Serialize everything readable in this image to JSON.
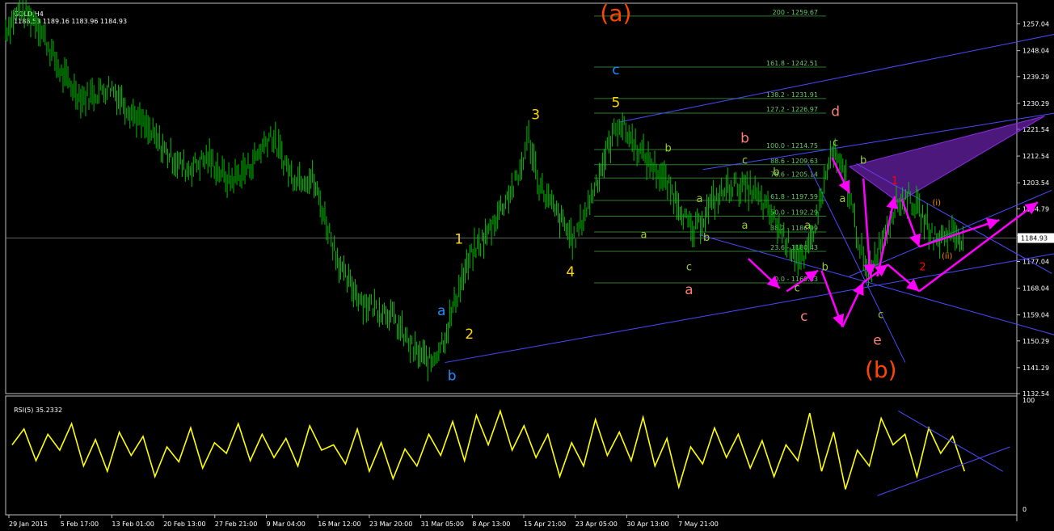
{
  "header": {
    "symbol": "GOLD,H4",
    "ohlc": "1188.53 1189.16 1183.96 1184.93",
    "rsi_label": "RSI(5) 35.2332"
  },
  "colors": {
    "background": "#000000",
    "grid_border": "#c0c0c0",
    "bars": "#00c000",
    "rsi": "#ffff00",
    "channel": "#4b4bff",
    "fib": "#2e7d2e",
    "fib_text": "#6ec86e",
    "magenta": "#ff00ff",
    "purple_pattern": "#8a2be2"
  },
  "chart_data": [
    {
      "type": "line",
      "title": "GOLD,H4",
      "xlabel": "",
      "ylabel": "",
      "ylim": [
        1132.54,
        1264.0
      ],
      "grid": false,
      "x_tick_labels": [
        "29 Jan 2015",
        "5 Feb 17:00",
        "13 Feb 01:00",
        "20 Feb 13:00",
        "27 Feb 21:00",
        "9 Mar 04:00",
        "16 Mar 12:00",
        "23 Mar 20:00",
        "31 Mar 05:00",
        "8 Apr 13:00",
        "15 Apr 21:00",
        "23 Apr 05:00",
        "30 Apr 13:00",
        "7 May 21:00"
      ],
      "y_tick_labels": [
        "1257.04",
        "1248.04",
        "1239.29",
        "1230.29",
        "1221.54",
        "1212.54",
        "1203.54",
        "1194.79",
        "1185.79",
        "1177.04",
        "1168.04",
        "1159.04",
        "1150.29",
        "1141.29",
        "1132.54"
      ],
      "y_ticks": [
        1257.04,
        1248.04,
        1239.29,
        1230.29,
        1221.54,
        1212.54,
        1203.54,
        1194.79,
        1185.79,
        1177.04,
        1168.04,
        1159.04,
        1150.29,
        1141.29,
        1132.54
      ],
      "current_price": "1184.93",
      "price_path": [
        {
          "x": 0,
          "y": 1255
        },
        {
          "x": 4,
          "y": 1262
        },
        {
          "x": 9,
          "y": 1258
        },
        {
          "x": 16,
          "y": 1240
        },
        {
          "x": 22,
          "y": 1232
        },
        {
          "x": 30,
          "y": 1236
        },
        {
          "x": 38,
          "y": 1225
        },
        {
          "x": 46,
          "y": 1214
        },
        {
          "x": 52,
          "y": 1208
        },
        {
          "x": 58,
          "y": 1212
        },
        {
          "x": 64,
          "y": 1204
        },
        {
          "x": 70,
          "y": 1209
        },
        {
          "x": 76,
          "y": 1220
        },
        {
          "x": 82,
          "y": 1206
        },
        {
          "x": 88,
          "y": 1205
        },
        {
          "x": 92,
          "y": 1190
        },
        {
          "x": 97,
          "y": 1172
        },
        {
          "x": 103,
          "y": 1163
        },
        {
          "x": 110,
          "y": 1160
        },
        {
          "x": 117,
          "y": 1147
        },
        {
          "x": 122,
          "y": 1143
        },
        {
          "x": 126,
          "y": 1152
        },
        {
          "x": 130,
          "y": 1168
        },
        {
          "x": 134,
          "y": 1180
        },
        {
          "x": 138,
          "y": 1186
        },
        {
          "x": 142,
          "y": 1195
        },
        {
          "x": 147,
          "y": 1205
        },
        {
          "x": 150,
          "y": 1219
        },
        {
          "x": 153,
          "y": 1203
        },
        {
          "x": 158,
          "y": 1193
        },
        {
          "x": 163,
          "y": 1184
        },
        {
          "x": 168,
          "y": 1199
        },
        {
          "x": 173,
          "y": 1216
        },
        {
          "x": 176,
          "y": 1224
        },
        {
          "x": 182,
          "y": 1214
        },
        {
          "x": 188,
          "y": 1206
        },
        {
          "x": 193,
          "y": 1197
        },
        {
          "x": 197,
          "y": 1186
        },
        {
          "x": 202,
          "y": 1196
        },
        {
          "x": 208,
          "y": 1203
        },
        {
          "x": 214,
          "y": 1201
        },
        {
          "x": 220,
          "y": 1192
        },
        {
          "x": 225,
          "y": 1182
        },
        {
          "x": 229,
          "y": 1176
        },
        {
          "x": 233,
          "y": 1194
        },
        {
          "x": 237,
          "y": 1214
        },
        {
          "x": 241,
          "y": 1205
        },
        {
          "x": 244,
          "y": 1188
        },
        {
          "x": 247,
          "y": 1172
        },
        {
          "x": 251,
          "y": 1183
        },
        {
          "x": 255,
          "y": 1196
        },
        {
          "x": 259,
          "y": 1199
        },
        {
          "x": 263,
          "y": 1192
        },
        {
          "x": 267,
          "y": 1184
        },
        {
          "x": 271,
          "y": 1187
        },
        {
          "x": 275,
          "y": 1184.93
        }
      ],
      "annotations": [
        {
          "text": "(a)",
          "x": 175,
          "y": 1258,
          "color": "#ff4500",
          "size": "large"
        },
        {
          "text": "c",
          "x": 175,
          "y": 1240,
          "color": "#1e90ff",
          "size": "medium"
        },
        {
          "text": "5",
          "x": 175,
          "y": 1229,
          "color": "#ffd700",
          "size": "medium"
        },
        {
          "text": "3",
          "x": 152,
          "y": 1225,
          "color": "#ffd700",
          "size": "medium"
        },
        {
          "text": "1",
          "x": 130,
          "y": 1183,
          "color": "#ffd700",
          "size": "medium"
        },
        {
          "text": "2",
          "x": 133,
          "y": 1151,
          "color": "#ffd700",
          "size": "medium"
        },
        {
          "text": "4",
          "x": 162,
          "y": 1172,
          "color": "#ffd700",
          "size": "medium"
        },
        {
          "text": "a",
          "x": 125,
          "y": 1159,
          "color": "#1e90ff",
          "size": "medium"
        },
        {
          "text": "b",
          "x": 128,
          "y": 1137,
          "color": "#1e90ff",
          "size": "medium"
        },
        {
          "text": "b",
          "x": 190,
          "y": 1214,
          "color": "#9acd32",
          "size": "small"
        },
        {
          "text": "a",
          "x": 183,
          "y": 1185,
          "color": "#9acd32",
          "size": "small"
        },
        {
          "text": "a",
          "x": 199,
          "y": 1197,
          "color": "#9acd32",
          "size": "small"
        },
        {
          "text": "b",
          "x": 201,
          "y": 1184,
          "color": "#9acd32",
          "size": "small"
        },
        {
          "text": "c",
          "x": 196,
          "y": 1174,
          "color": "#9acd32",
          "size": "small"
        },
        {
          "text": "c",
          "x": 212,
          "y": 1210,
          "color": "#9acd32",
          "size": "small"
        },
        {
          "text": "a",
          "x": 212,
          "y": 1188,
          "color": "#9acd32",
          "size": "small"
        },
        {
          "text": "b",
          "x": 221,
          "y": 1206,
          "color": "#9acd32",
          "size": "small"
        },
        {
          "text": "b",
          "x": 212,
          "y": 1217,
          "color": "#fa8072",
          "size": "medium"
        },
        {
          "text": "a",
          "x": 196,
          "y": 1166,
          "color": "#fa8072",
          "size": "medium"
        },
        {
          "text": "a",
          "x": 230,
          "y": 1188,
          "color": "#9acd32",
          "size": "small"
        },
        {
          "text": "b",
          "x": 235,
          "y": 1174,
          "color": "#9acd32",
          "size": "small"
        },
        {
          "text": "c",
          "x": 227,
          "y": 1167,
          "color": "#9acd32",
          "size": "small"
        },
        {
          "text": "c",
          "x": 229,
          "y": 1157,
          "color": "#fa8072",
          "size": "medium"
        },
        {
          "text": "d",
          "x": 238,
          "y": 1226,
          "color": "#fa8072",
          "size": "medium"
        },
        {
          "text": "c",
          "x": 238,
          "y": 1216,
          "color": "#9acd32",
          "size": "small"
        },
        {
          "text": "b",
          "x": 246,
          "y": 1210,
          "color": "#9acd32",
          "size": "small"
        },
        {
          "text": "a",
          "x": 240,
          "y": 1197,
          "color": "#9acd32",
          "size": "small"
        },
        {
          "text": "c",
          "x": 251,
          "y": 1158,
          "color": "#9acd32",
          "size": "small"
        },
        {
          "text": "e",
          "x": 250,
          "y": 1149,
          "color": "#fa8072",
          "size": "medium"
        },
        {
          "text": "(b)",
          "x": 251,
          "y": 1138,
          "color": "#ff4500",
          "size": "large"
        },
        {
          "text": "1",
          "x": 255,
          "y": 1203,
          "color": "#ff0000",
          "size": "small"
        },
        {
          "text": "2",
          "x": 263,
          "y": 1174,
          "color": "#ff0000",
          "size": "small"
        },
        {
          "text": "(i)",
          "x": 267,
          "y": 1196,
          "color": "#ff8c00",
          "size": "tiny"
        },
        {
          "text": "(ii)",
          "x": 270,
          "y": 1178,
          "color": "#ff8c00",
          "size": "tiny"
        }
      ],
      "fibonacci": [
        {
          "label": "200 - 1259.67",
          "value": 1259.67
        },
        {
          "label": "161.8 - 1242.51",
          "value": 1242.51
        },
        {
          "label": "138.2 - 1231.91",
          "value": 1231.91
        },
        {
          "label": "127.2 - 1226.97",
          "value": 1226.97
        },
        {
          "label": "100.0 - 1214.75",
          "value": 1214.75
        },
        {
          "label": "88.6 - 1209.63",
          "value": 1209.63
        },
        {
          "label": "78.6 - 1205.14",
          "value": 1205.14
        },
        {
          "label": "61.8 - 1197.59",
          "value": 1197.59
        },
        {
          "label": "50.0 - 1192.29",
          "value": 1192.29
        },
        {
          "label": "38.2 - 1186.99",
          "value": 1186.99
        },
        {
          "label": "23.6 - 1180.43",
          "value": 1180.43
        },
        {
          "label": "0.0 - 1169.83",
          "value": 1169.83
        }
      ],
      "trendlines": [
        {
          "x1": 176,
          "y1": 1224,
          "x2": 345,
          "y2": 1264
        },
        {
          "x1": 200,
          "y1": 1208,
          "x2": 370,
          "y2": 1240
        },
        {
          "x1": 126,
          "y1": 1143,
          "x2": 393,
          "y2": 1199
        },
        {
          "x1": 199,
          "y1": 1186,
          "x2": 335,
          "y2": 1141
        },
        {
          "x1": 230,
          "y1": 1210,
          "x2": 258,
          "y2": 1143
        },
        {
          "x1": 244,
          "y1": 1210,
          "x2": 300,
          "y2": 1173
        },
        {
          "x1": 242,
          "y1": 1172,
          "x2": 300,
          "y2": 1201
        }
      ],
      "pattern_triangle": [
        {
          "x": 242,
          "y": 1209
        },
        {
          "x": 298,
          "y": 1226
        },
        {
          "x": 256,
          "y": 1197
        }
      ],
      "projection_arrows": [
        [
          {
            "x": 213,
            "y": 1178
          },
          {
            "x": 222,
            "y": 1168
          }
        ],
        [
          {
            "x": 224,
            "y": 1167
          },
          {
            "x": 233,
            "y": 1174
          }
        ],
        [
          {
            "x": 234,
            "y": 1174
          },
          {
            "x": 240,
            "y": 1155
          }
        ],
        [
          {
            "x": 240,
            "y": 1155
          },
          {
            "x": 246,
            "y": 1170
          }
        ],
        [
          {
            "x": 246,
            "y": 1170
          },
          {
            "x": 253,
            "y": 1176
          }
        ],
        [
          {
            "x": 253,
            "y": 1176
          },
          {
            "x": 262,
            "y": 1167
          }
        ],
        [
          {
            "x": 262,
            "y": 1167
          },
          {
            "x": 296,
            "y": 1197
          }
        ],
        [
          {
            "x": 237,
            "y": 1212
          },
          {
            "x": 242,
            "y": 1200
          }
        ],
        [
          {
            "x": 246,
            "y": 1205
          },
          {
            "x": 248,
            "y": 1172
          }
        ],
        [
          {
            "x": 250,
            "y": 1172
          },
          {
            "x": 255,
            "y": 1199
          }
        ],
        [
          {
            "x": 257,
            "y": 1198
          },
          {
            "x": 262,
            "y": 1182
          }
        ],
        [
          {
            "x": 262,
            "y": 1182
          },
          {
            "x": 285,
            "y": 1191
          }
        ]
      ]
    },
    {
      "type": "line",
      "title": "RSI(5) 35.2332",
      "ylim": [
        0,
        100
      ],
      "y_tick_labels": [
        "100",
        "0"
      ],
      "series": [
        {
          "values": [
            60,
            75,
            45,
            70,
            55,
            80,
            40,
            65,
            35,
            72,
            50,
            68,
            30,
            58,
            44,
            76,
            38,
            62,
            52,
            80,
            45,
            70,
            48,
            66,
            40,
            78,
            55,
            60,
            42,
            75,
            35,
            62,
            28,
            56,
            40,
            70,
            50,
            82,
            45,
            88,
            60,
            92,
            55,
            78,
            48,
            70,
            30,
            62,
            40,
            84,
            50,
            72,
            45,
            86,
            40,
            66,
            20,
            58,
            42,
            76,
            48,
            70,
            38,
            64,
            30,
            60,
            45,
            90,
            35,
            72,
            18,
            55,
            40,
            85,
            60,
            70,
            30,
            76,
            52,
            68,
            35
          ]
        },
        {
          "values": []
        }
      ],
      "trendlines": [
        {
          "x1": 256,
          "y1": 92,
          "x2": 286,
          "y2": 35
        },
        {
          "x1": 250,
          "y1": 12,
          "x2": 288,
          "y2": 58
        }
      ]
    }
  ]
}
